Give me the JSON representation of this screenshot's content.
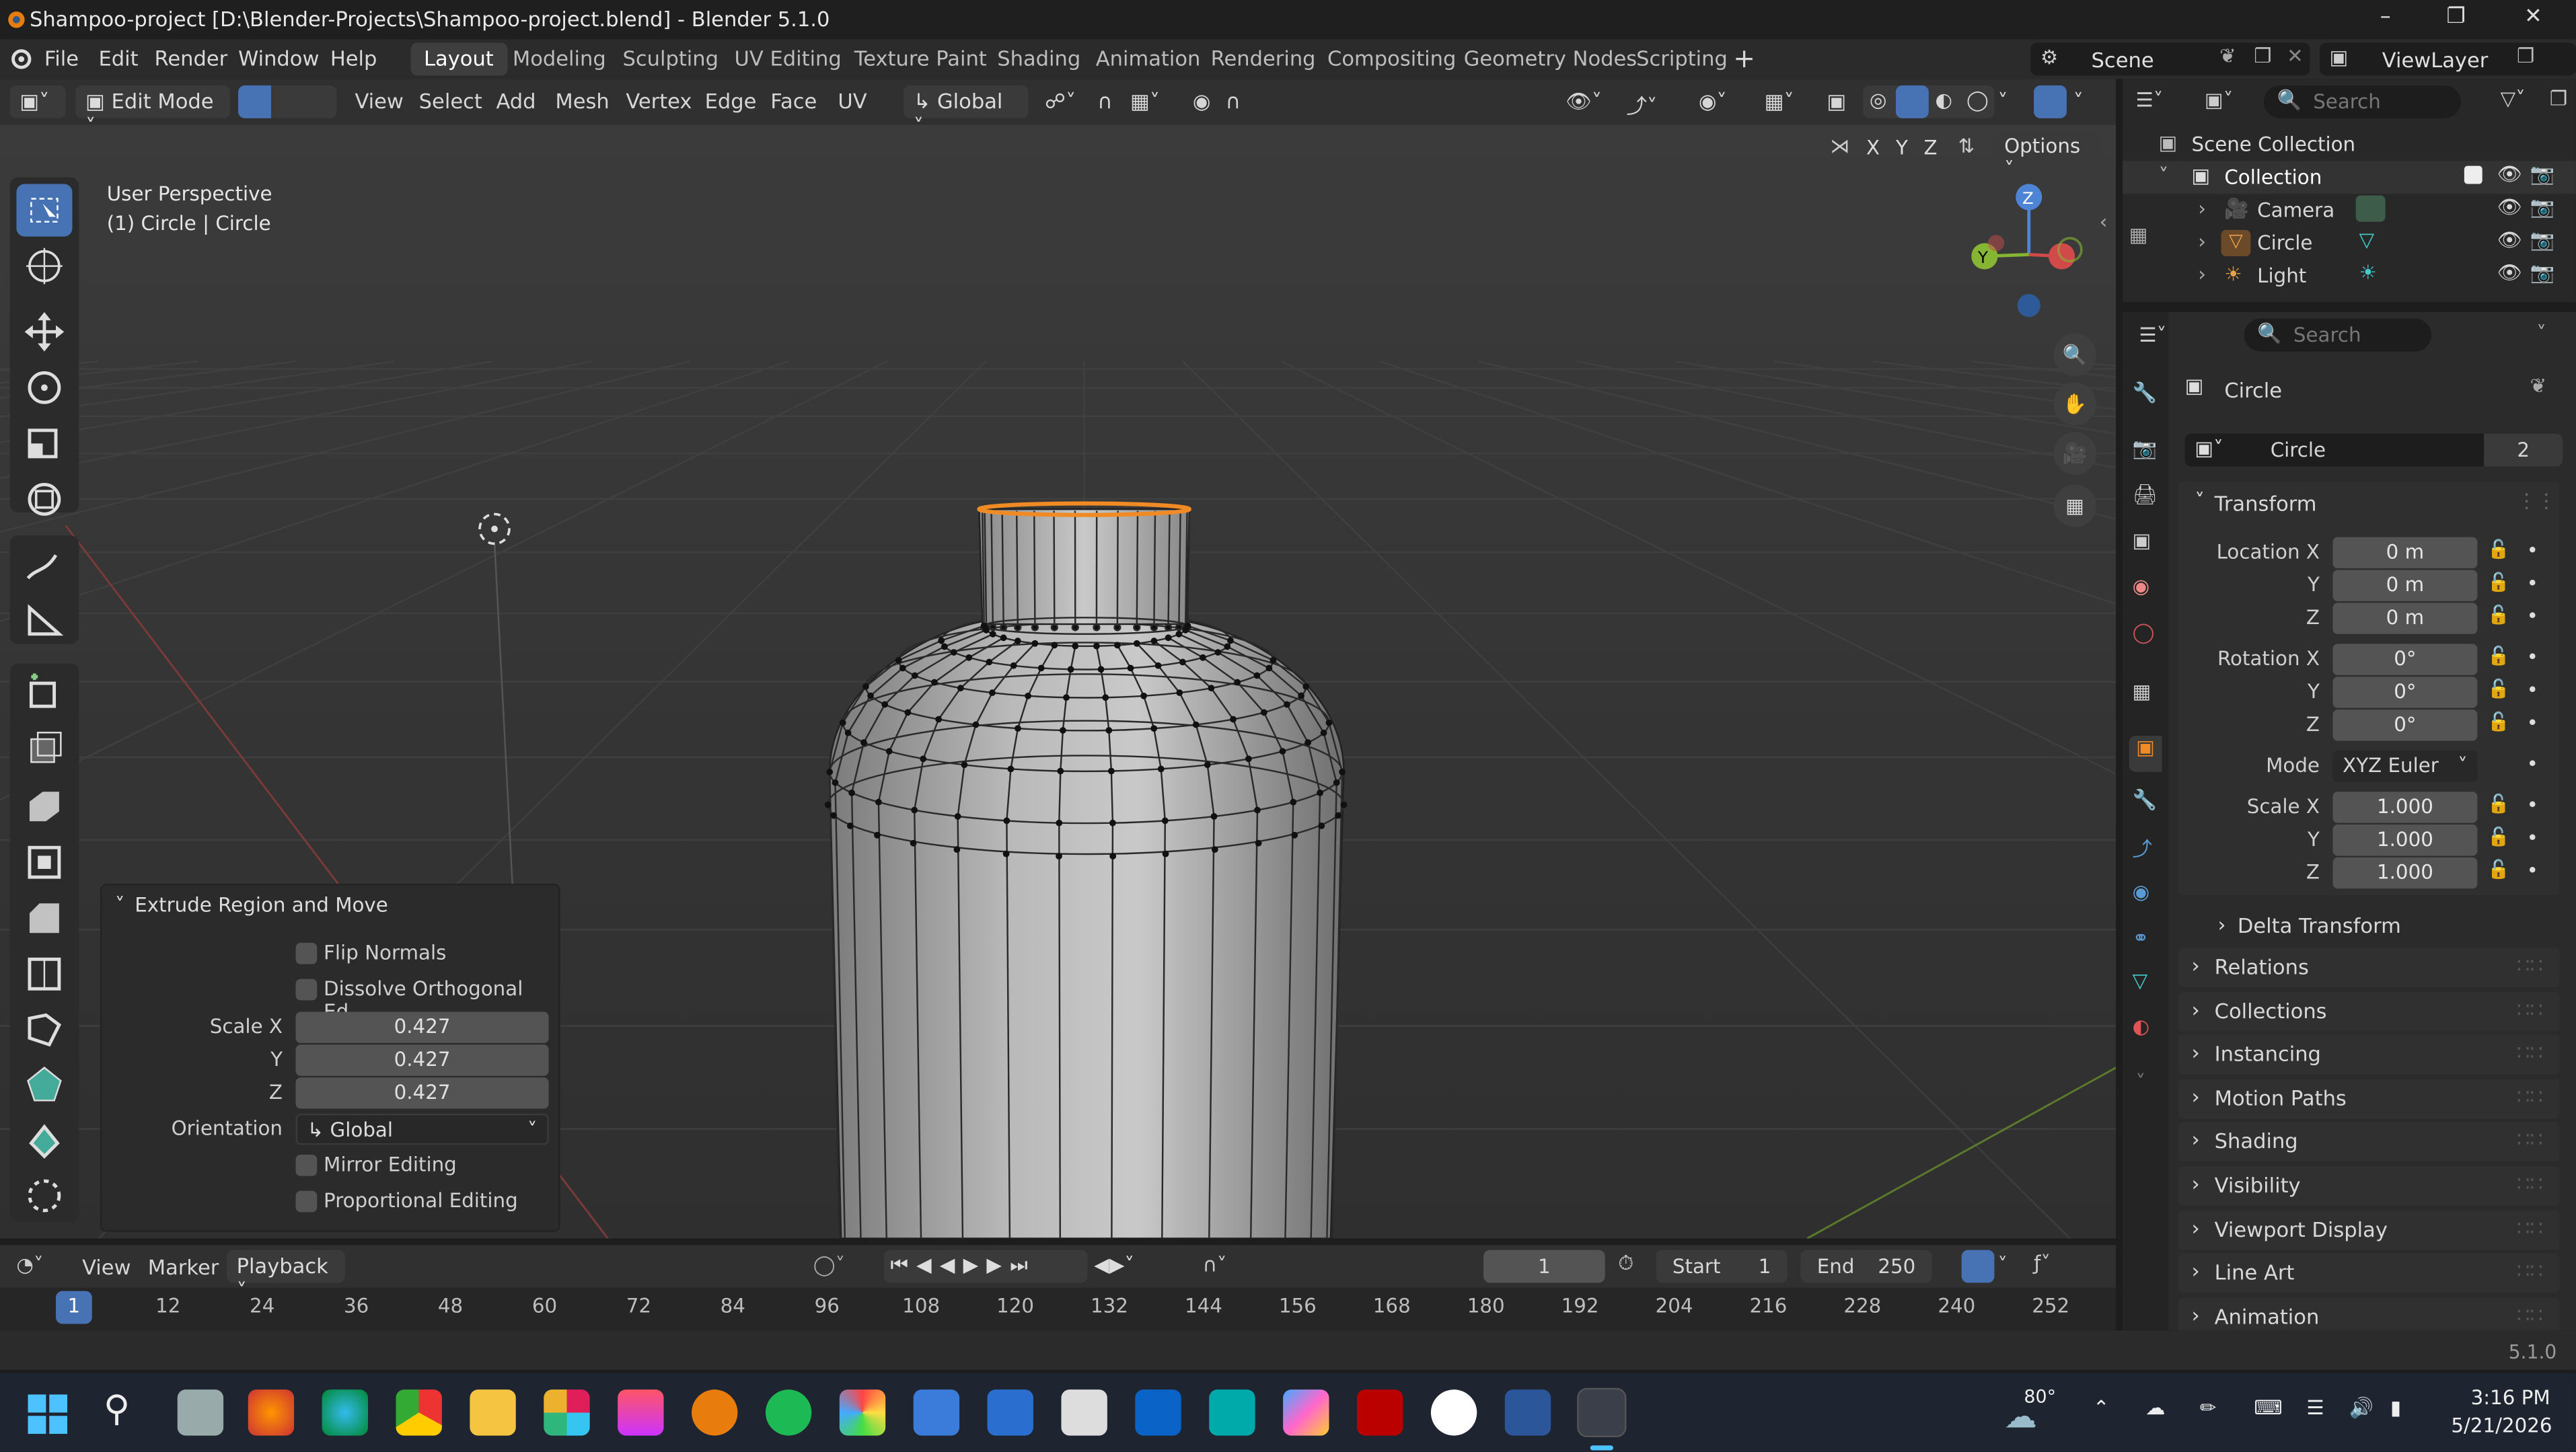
{
  "title_bar": {
    "title": "Shampoo-project [D:\\Blender-Projects\\Shampoo-project.blend] - Blender 5.1.0"
  },
  "menu": [
    "File",
    "Edit",
    "Render",
    "Window",
    "Help"
  ],
  "workspaces": [
    "Layout",
    "Modeling",
    "Sculpting",
    "UV Editing",
    "Texture Paint",
    "Shading",
    "Animation",
    "Rendering",
    "Compositing",
    "Geometry Nodes",
    "Scripting"
  ],
  "active_workspace": "Layout",
  "scene": {
    "label": "Scene"
  },
  "view_layer": {
    "label": "ViewLayer"
  },
  "viewport_header": {
    "mode": "Edit Mode",
    "menus": [
      "View",
      "Select",
      "Add",
      "Mesh",
      "Vertex",
      "Edge",
      "Face",
      "UV"
    ],
    "orientation": "Global",
    "options_label": "Options",
    "axes": [
      "X",
      "Y",
      "Z"
    ]
  },
  "viewport": {
    "perspective": "User Perspective",
    "object_info": "(1) Circle | Circle",
    "gizmo_axes": [
      "Z",
      "Y",
      "X"
    ]
  },
  "redo_panel": {
    "title": "Extrude Region and Move",
    "flip_normals": "Flip Normals",
    "dissolve": "Dissolve Orthogonal Ed...",
    "scale_label": "Scale X",
    "scale_y_label": "Y",
    "scale_z_label": "Z",
    "scale": [
      "0.427",
      "0.427",
      "0.427"
    ],
    "orientation_label": "Orientation",
    "orientation": "Global",
    "mirror_editing": "Mirror Editing",
    "proportional_editing": "Proportional Editing"
  },
  "outliner": {
    "search_placeholder": "Search",
    "scene_collection": "Scene Collection",
    "collection": "Collection",
    "items": [
      {
        "name": "Camera",
        "color": "#7f9b3c"
      },
      {
        "name": "Circle",
        "color": "#e08d3c"
      },
      {
        "name": "Light",
        "color": "#c79a3a"
      }
    ]
  },
  "properties": {
    "search_placeholder": "Search",
    "object_name": "Circle",
    "data_name": "Circle",
    "data_users": "2",
    "transform_label": "Transform",
    "location_label": "Location X",
    "rotation_label": "Rotation X",
    "scale_label": "Scale X",
    "y_label": "Y",
    "z_label": "Z",
    "location": [
      "0 m",
      "0 m",
      "0 m"
    ],
    "rotation": [
      "0°",
      "0°",
      "0°"
    ],
    "mode_label": "Mode",
    "mode": "XYZ Euler",
    "scale": [
      "1.000",
      "1.000",
      "1.000"
    ],
    "delta_transform": "Delta Transform",
    "panels": [
      "Relations",
      "Collections",
      "Instancing",
      "Motion Paths",
      "Shading",
      "Visibility",
      "Viewport Display",
      "Line Art",
      "Animation"
    ]
  },
  "timeline": {
    "menus": [
      "View",
      "Marker",
      "Playback"
    ],
    "current_frame": "1",
    "start_label": "Start",
    "start": "1",
    "end_label": "End",
    "end": "250",
    "frames": [
      "1",
      "12",
      "24",
      "36",
      "48",
      "60",
      "72",
      "84",
      "96",
      "108",
      "120",
      "132",
      "144",
      "156",
      "168",
      "180",
      "192",
      "204",
      "216",
      "228",
      "240",
      "252"
    ]
  },
  "status_bar": {
    "version": "5.1.0"
  },
  "taskbar": {
    "weather": "80°",
    "time": "3:16 PM",
    "date": "5/21/2026"
  },
  "colors": {
    "accent": "#4772b3",
    "selection": "#f08a24",
    "workspace_active": "#3e3e3e"
  }
}
